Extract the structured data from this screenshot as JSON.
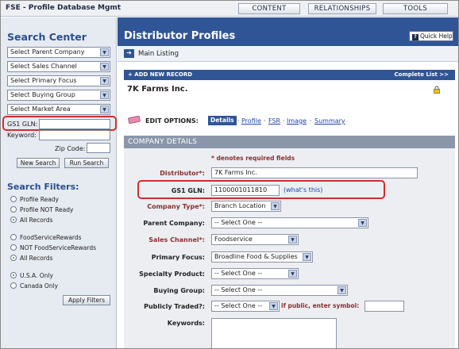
{
  "app": {
    "title": "FSE - Profile Database Mgmt"
  },
  "topnav": {
    "items": [
      "CONTENT",
      "RELATIONSHIPS",
      "TOOLS"
    ]
  },
  "search_center": {
    "title": "Search Center",
    "selects": [
      "Select Parent Company",
      "Select Sales Channel",
      "Select Primary Focus",
      "Select Buying Group",
      "Select Market Area"
    ],
    "gs1_label": "GS1 GLN:",
    "keyword_label": "Keyword:",
    "zip_label": "Zip Code:",
    "new_search": "New Search",
    "run_search": "Run Search"
  },
  "search_filters": {
    "title": "Search Filters:",
    "group1": [
      "Profile Ready",
      "Profile NOT Ready",
      "All Records"
    ],
    "group2": [
      "FoodServiceRewards",
      "NOT FoodServiceRewards",
      "All Records"
    ],
    "group3": [
      "U.S.A. Only",
      "Canada Only"
    ],
    "apply": "Apply Filters"
  },
  "main": {
    "title": "Distributor Profiles",
    "quick_help": "Quick Help",
    "main_listing": "Main Listing",
    "add_new": "+ ADD NEW RECORD",
    "complete_list": "Complete List  >>",
    "company_name": "7K Farms Inc.",
    "edit_options": "EDIT OPTIONS:",
    "tabs": {
      "active": "Details",
      "links": [
        "Profile",
        "FSR",
        "Image",
        "Summary"
      ]
    },
    "section": "COMPANY DETAILS",
    "required_note": "* denotes required fields"
  },
  "form": {
    "distributor": {
      "label": "Distributor*:",
      "value": "7K Farms Inc."
    },
    "gs1": {
      "label": "GS1 GLN:",
      "value": "1100001011810",
      "help": "(what's this)"
    },
    "company_type": {
      "label": "Company Type*:",
      "value": "Branch Location"
    },
    "parent_company": {
      "label": "Parent Company:",
      "value": "-- Select One --"
    },
    "sales_channel": {
      "label": "Sales Channel*:",
      "value": "Foodservice"
    },
    "primary_focus": {
      "label": "Primary Focus:",
      "value": "Broadline Food & Supplies"
    },
    "specialty_product": {
      "label": "Specialty Product:",
      "value": "-- Select One --"
    },
    "buying_group": {
      "label": "Buying Group:",
      "value": "-- Select One --"
    },
    "publicly_traded": {
      "label": "Publicly Traded?:",
      "value": "-- Select One --",
      "note": "if public, enter symbol:"
    },
    "keywords": {
      "label": "Keywords:"
    }
  },
  "colors": {
    "accent": "#2f5596",
    "highlight": "#d42c2c",
    "required": "#8c2f2f"
  }
}
